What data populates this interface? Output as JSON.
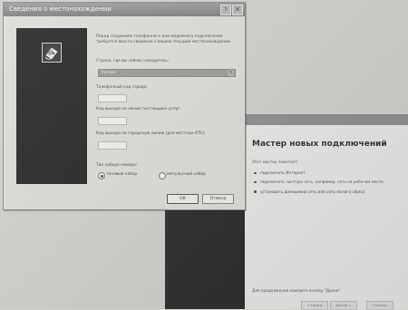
{
  "dialog": {
    "title": "Сведения о местонахождении",
    "help_glyph": "?",
    "close_glyph": "✕",
    "description": "Перед созданием телефонного или модемного подключения требуется ввести сведения о вашем текущем местонахождении.",
    "country_label": "Страна, где вы сейчас находитесь:",
    "country_value": "Россия",
    "area_code_label": "Телефонный код города:",
    "carrier_label": "Код выхода на линию поставщика услуг:",
    "outside_line_label": "Код выхода на городскую линию (для местных АТС):",
    "dialing_type_label": "Тип набора номера:",
    "tone_label": "тоновый набор",
    "pulse_label": "импульсный набор",
    "ok_label": "ОК",
    "cancel_label": "Отмена"
  },
  "wizard": {
    "title": "Мастер новых подключений",
    "intro": "Этот мастер помогает:",
    "bullets": [
      "подключить Интернет",
      "подключить частную сеть, например, сеть на рабочем месте",
      "установить домашнюю сеть или сеть малого офиса"
    ],
    "footer": "Для продолжения нажмите кнопку \"Далее\".",
    "back_label": "< Назад",
    "next_label": "Далее >",
    "cancel_label": "Отмена"
  }
}
